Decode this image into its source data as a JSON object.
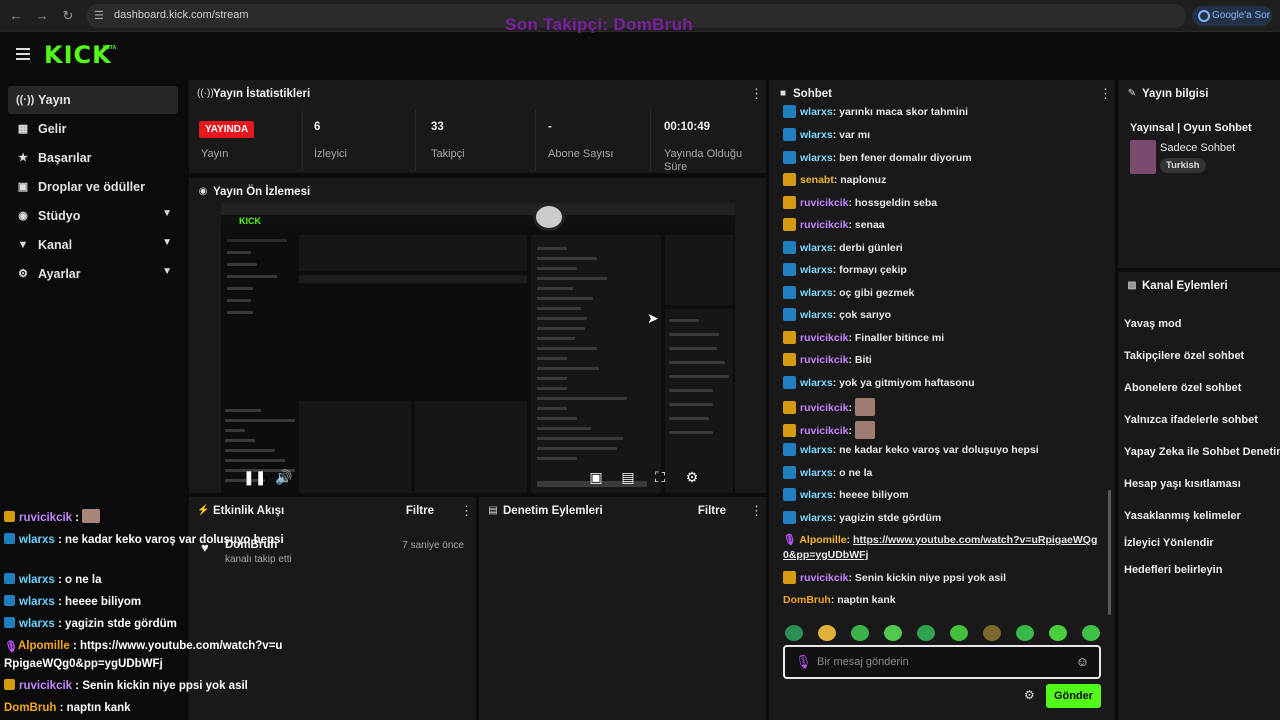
{
  "browser": {
    "url": "dashboard.kick.com/stream",
    "google_button": "Google'a Sor"
  },
  "overlay_follower": "Son Takipçi: DomBruh",
  "logo": {
    "text": "KICK",
    "beta": "BETA"
  },
  "sidebar": {
    "items": [
      {
        "label": "Yayın",
        "icon": "broadcast-icon"
      },
      {
        "label": "Gelir",
        "icon": "revenue-icon"
      },
      {
        "label": "Başarılar",
        "icon": "trophy-icon"
      },
      {
        "label": "Droplar ve ödüller",
        "icon": "gift-icon"
      },
      {
        "label": "Stüdyo",
        "icon": "studio-icon"
      },
      {
        "label": "Kanal",
        "icon": "channel-icon"
      },
      {
        "label": "Ayarlar",
        "icon": "gear-icon"
      }
    ]
  },
  "stats": {
    "title": "Yayın İstatistikleri",
    "live_badge": "YAYINDA",
    "items": [
      {
        "value": "",
        "label": "Yayın"
      },
      {
        "value": "6",
        "label": "İzleyici"
      },
      {
        "value": "33",
        "label": "Takipçi"
      },
      {
        "value": "-",
        "label": "Abone Sayısı"
      },
      {
        "value": "00:10:49",
        "label": "Yayında Olduğu Süre"
      }
    ]
  },
  "preview": {
    "title": "Yayın Ön İzlemesi"
  },
  "activity": {
    "title": "Etkinlik Akışı",
    "filter": "Filtre",
    "event_name": "DomBruh",
    "event_desc": "kanalı takip etti",
    "event_time": "7 saniye önce"
  },
  "moderation": {
    "title": "Denetim Eylemleri",
    "filter": "Filtre"
  },
  "chat": {
    "title": "Sohbet",
    "messages": [
      {
        "user": "wlarxs",
        "text": "yarınkı maca skor tahmini",
        "badge": "blue"
      },
      {
        "user": "wlarxs",
        "text": "var mı",
        "badge": "blue"
      },
      {
        "user": "wlarxs",
        "text": "ben fener domalır diyorum",
        "badge": "blue"
      },
      {
        "user": "senabt",
        "text": "naplonuz",
        "badge": "gold"
      },
      {
        "user": "ruvicikcik",
        "text": "hossgeldin seba",
        "badge": "gold"
      },
      {
        "user": "ruvicikcik",
        "text": "senaa",
        "badge": "gold"
      },
      {
        "user": "wlarxs",
        "text": "derbi günleri",
        "badge": "blue"
      },
      {
        "user": "wlarxs",
        "text": "formayı çekip",
        "badge": "blue"
      },
      {
        "user": "wlarxs",
        "text": "oç gibi gezmek",
        "badge": "blue"
      },
      {
        "user": "wlarxs",
        "text": "çok sarıyo",
        "badge": "blue"
      },
      {
        "user": "ruvicikcik",
        "text": "Finaller bitince mi",
        "badge": "gold"
      },
      {
        "user": "ruvicikcik",
        "text": "Biti",
        "badge": "gold"
      },
      {
        "user": "wlarxs",
        "text": "yok ya gitmiyom haftasonu",
        "badge": "blue"
      },
      {
        "user": "ruvicikcik",
        "text": "",
        "badge": "gold",
        "emote": true
      },
      {
        "user": "ruvicikcik",
        "text": "",
        "badge": "gold",
        "emote": true
      },
      {
        "user": "wlarxs",
        "text": "ne kadar keko varoş var doluşuyo hepsi",
        "badge": "blue"
      },
      {
        "user": "wlarxs",
        "text": "o ne la",
        "badge": "blue"
      },
      {
        "user": "wlarxs",
        "text": "heeee biliyom",
        "badge": "blue"
      },
      {
        "user": "wlarxs",
        "text": "yagizin stde gördüm",
        "badge": "blue"
      },
      {
        "user": "Alpomille",
        "text": "https://www.youtube.com/watch?v=uRpigaeWQg0&pp=ygUDbWFj",
        "badge": "mic",
        "link": true
      },
      {
        "user": "ruvicikcik",
        "text": "Senin kickin niye ppsi yok asil",
        "badge": "gold"
      },
      {
        "user": "DomBruh",
        "text": "naptın kank",
        "badge": "none"
      }
    ],
    "input_placeholder": "Bir mesaj gönderin",
    "send_label": "Gönder"
  },
  "overlay_chat": [
    {
      "user": "ruvicikcik",
      "text": "",
      "badge": "gold",
      "emote": true
    },
    {
      "user": "wlarxs",
      "text": "ne kadar keko varoş var doluşuyo hepsi",
      "badge": "blue"
    },
    {
      "user": "wlarxs",
      "text": "o ne la",
      "badge": "blue"
    },
    {
      "user": "wlarxs",
      "text": "heeee biliyom",
      "badge": "blue"
    },
    {
      "user": "wlarxs",
      "text": "yagizin stde gördüm",
      "badge": "blue"
    },
    {
      "user": "Alpomille",
      "text": "https://www.youtube.com/watch?v=uRpigaeWQg0&pp=ygUDbWFj",
      "badge": "mic"
    },
    {
      "user": "ruvicikcik",
      "text": "Senin kickin niye ppsi yok asil",
      "badge": "gold"
    },
    {
      "user": "DomBruh",
      "text": "naptın kank",
      "badge": "none"
    }
  ],
  "stream_info": {
    "title": "Yayın bilgisi",
    "stream_title": "Yayınsal | Oyun Sohbet",
    "category": "Sadece Sohbet",
    "tag": "Turkish"
  },
  "channel_actions": {
    "title": "Kanal Eylemleri",
    "items": [
      "Yavaş mod",
      "Takipçilere özel sohbet",
      "Abonelere özel sohbet",
      "Yalnızca ifadelerle sohbet",
      "Yapay Zeka ile Sohbet Denetimi",
      "Hesap yaşı kısıtlaması",
      "Yasaklanmış kelimeler",
      "İzleyici Yönlendir",
      "Hedefleri belirleyin"
    ]
  },
  "colors": {
    "brand": "#53fc18",
    "live": "#e5181f",
    "panel": "#191919"
  }
}
